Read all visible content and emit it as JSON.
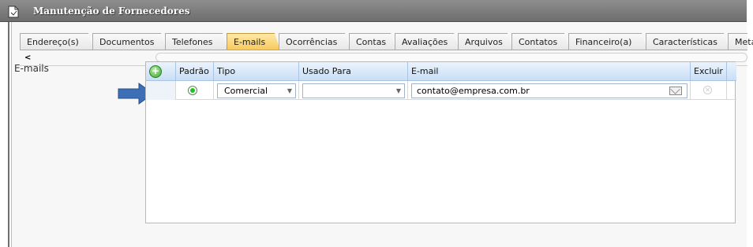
{
  "window": {
    "title": "Manutenção de Fornecedores"
  },
  "tabs": [
    {
      "label": "Endereço(s)"
    },
    {
      "label": "Documentos"
    },
    {
      "label": "Telefones"
    },
    {
      "label": "E-mails",
      "active": true
    },
    {
      "label": "Ocorrências"
    },
    {
      "label": "Contas"
    },
    {
      "label": "Avaliações"
    },
    {
      "label": "Arquivos"
    },
    {
      "label": "Contatos"
    },
    {
      "label": "Financeiro(a)"
    },
    {
      "label": "Características"
    },
    {
      "label": "Meta"
    }
  ],
  "tab_scroll_left": "<",
  "section": {
    "label": "E-mails"
  },
  "grid": {
    "add_icon": "+",
    "columns": {
      "padrao": "Padrão",
      "tipo": "Tipo",
      "usado_para": "Usado Para",
      "email": "E-mail",
      "excluir": "Excluir"
    },
    "rows": [
      {
        "padrao": true,
        "tipo": "Comercial",
        "usado_para": "",
        "email": "contato@empresa.com.br"
      }
    ]
  },
  "colors": {
    "active_tab": "#f7c85b",
    "header": "#c9def5",
    "arrow": "#3c6fb5",
    "radio": "#1fc21f"
  }
}
